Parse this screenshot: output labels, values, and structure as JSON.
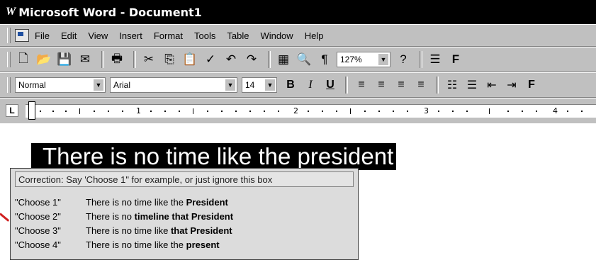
{
  "window": {
    "logo": "W",
    "title": "Microsoft Word - Document1"
  },
  "menubar": {
    "items": [
      "File",
      "Edit",
      "View",
      "Insert",
      "Format",
      "Tools",
      "Table",
      "Window",
      "Help"
    ]
  },
  "toolbar_standard": {
    "zoom": "127%",
    "show_hide": "¶",
    "last": "F"
  },
  "toolbar_formatting": {
    "style": "Normal",
    "font": "Arial",
    "size": "14",
    "bold": "B",
    "italic": "I",
    "underline": "U",
    "last": "F"
  },
  "ruler": {
    "marks": [
      "1",
      "2",
      "3",
      "4"
    ],
    "tab_selector": "L"
  },
  "document": {
    "selected_text": "There is no time like the president"
  },
  "correction_popup": {
    "header": "Correction: Say 'Choose 1\" for example, or just ignore this box",
    "choices": [
      {
        "key": "\"Choose 1\"",
        "prefix": "There is no time like the ",
        "bold": "President"
      },
      {
        "key": "\"Choose 2\"",
        "prefix": "There is no ",
        "bold": "timeline that President"
      },
      {
        "key": "\"Choose 3\"",
        "prefix": "There is no time like ",
        "bold": "that President"
      },
      {
        "key": "\"Choose 4\"",
        "prefix": "There is no time like the ",
        "bold": "present"
      }
    ]
  },
  "colors": {
    "title_bg": "#000000",
    "chrome": "#c0c0c0",
    "selection": "#000000",
    "annotation": "#d02020"
  }
}
